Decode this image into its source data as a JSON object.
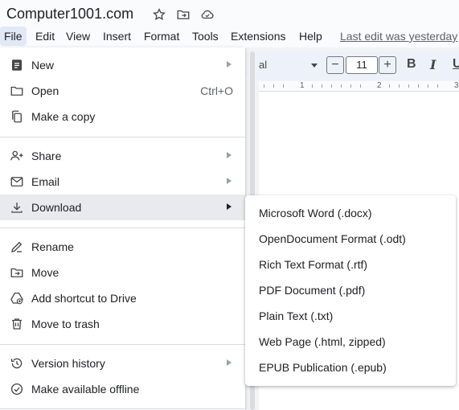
{
  "app": {
    "doc_title": "Computer1001.com",
    "title_icons": [
      "star-icon",
      "move-to-folder-icon",
      "cloud-saved-icon"
    ]
  },
  "menubar": {
    "items": [
      "File",
      "Edit",
      "View",
      "Insert",
      "Format",
      "Tools",
      "Extensions",
      "Help"
    ],
    "active": "File",
    "last_edit": "Last edit was yesterday"
  },
  "toolbar": {
    "font_name": "al",
    "font_size": "11",
    "minus": "−",
    "plus": "+",
    "bold": "B",
    "italic": "I",
    "underline": "U",
    "ruler_numbers": [
      "1",
      "2",
      "3"
    ]
  },
  "file_menu": {
    "items": [
      {
        "label": "New",
        "icon": "new-doc-icon",
        "submenu": true
      },
      {
        "label": "Open",
        "icon": "folder-icon",
        "shortcut": "Ctrl+O"
      },
      {
        "label": "Make a copy",
        "icon": "copy-icon"
      },
      {
        "label": "Share",
        "icon": "person-add-icon",
        "submenu": true
      },
      {
        "label": "Email",
        "icon": "email-icon",
        "submenu": true
      },
      {
        "label": "Download",
        "icon": "download-icon",
        "submenu": true,
        "highlighted": true
      },
      {
        "label": "Rename",
        "icon": "rename-icon"
      },
      {
        "label": "Move",
        "icon": "move-icon"
      },
      {
        "label": "Add shortcut to Drive",
        "icon": "drive-shortcut-icon"
      },
      {
        "label": "Move to trash",
        "icon": "trash-icon"
      },
      {
        "label": "Version history",
        "icon": "history-icon",
        "submenu": true
      },
      {
        "label": "Make available offline",
        "icon": "offline-icon"
      }
    ]
  },
  "download_submenu": {
    "items": [
      "Microsoft Word (.docx)",
      "OpenDocument Format (.odt)",
      "Rich Text Format (.rtf)",
      "PDF Document (.pdf)",
      "Plain Text (.txt)",
      "Web Page (.html, zipped)",
      "EPUB Publication (.epub)"
    ]
  },
  "colors": {
    "menu_highlight": "#e8eaed",
    "active_menu": "#e1e9f7",
    "icon": "#444746"
  }
}
